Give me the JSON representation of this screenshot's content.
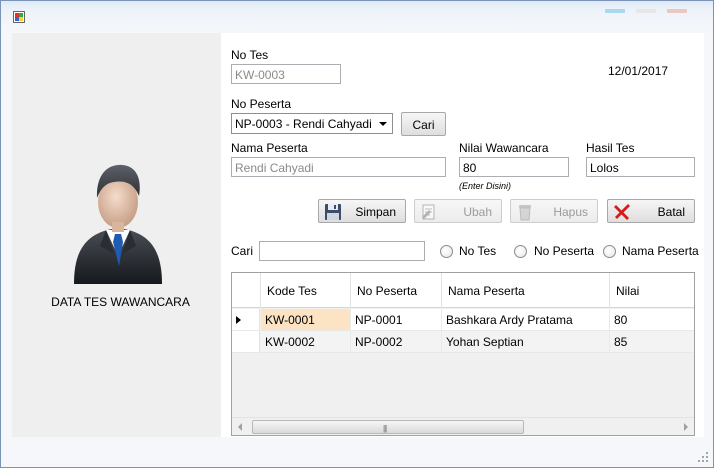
{
  "window": {
    "title": ""
  },
  "left_panel": {
    "title": "DATA TES WAWANCARA"
  },
  "form": {
    "no_tes_label": "No Tes",
    "no_tes_value": "KW-0003",
    "date": "12/01/2017",
    "no_peserta_label": "No Peserta",
    "no_peserta_selected": "NP-0003 - Rendi Cahyadi",
    "cari_button": "Cari",
    "nama_peserta_label": "Nama Peserta",
    "nama_peserta_value": "Rendi Cahyadi",
    "nilai_label": "Nilai Wawancara",
    "nilai_value": "80",
    "nilai_hint": "(Enter Disini)",
    "hasil_label": "Hasil Tes",
    "hasil_value": "Lolos"
  },
  "actions": {
    "simpan": "Simpan",
    "ubah": "Ubah",
    "hapus": "Hapus",
    "batal": "Batal"
  },
  "search": {
    "label": "Cari",
    "value": "",
    "options": [
      "No Tes",
      "No Peserta",
      "Nama Peserta"
    ]
  },
  "grid": {
    "columns": [
      "Kode Tes",
      "No Peserta",
      "Nama Peserta",
      "Nilai"
    ],
    "rows": [
      [
        "KW-0001",
        "NP-0001",
        "Bashkara Ardy Pratama",
        "80"
      ],
      [
        "KW-0002",
        "NP-0002",
        "Yohan Septian",
        "85"
      ]
    ]
  },
  "colors": {
    "selected_cell": "#fbe3c3",
    "left_panel": "#efefef",
    "batal_icon": "#d21d1d"
  },
  "icons": {
    "simpan": "floppy-disk-icon",
    "ubah": "edit-document-icon",
    "hapus": "trash-icon",
    "batal": "red-x-icon",
    "avatar": "businessman-avatar-icon"
  }
}
